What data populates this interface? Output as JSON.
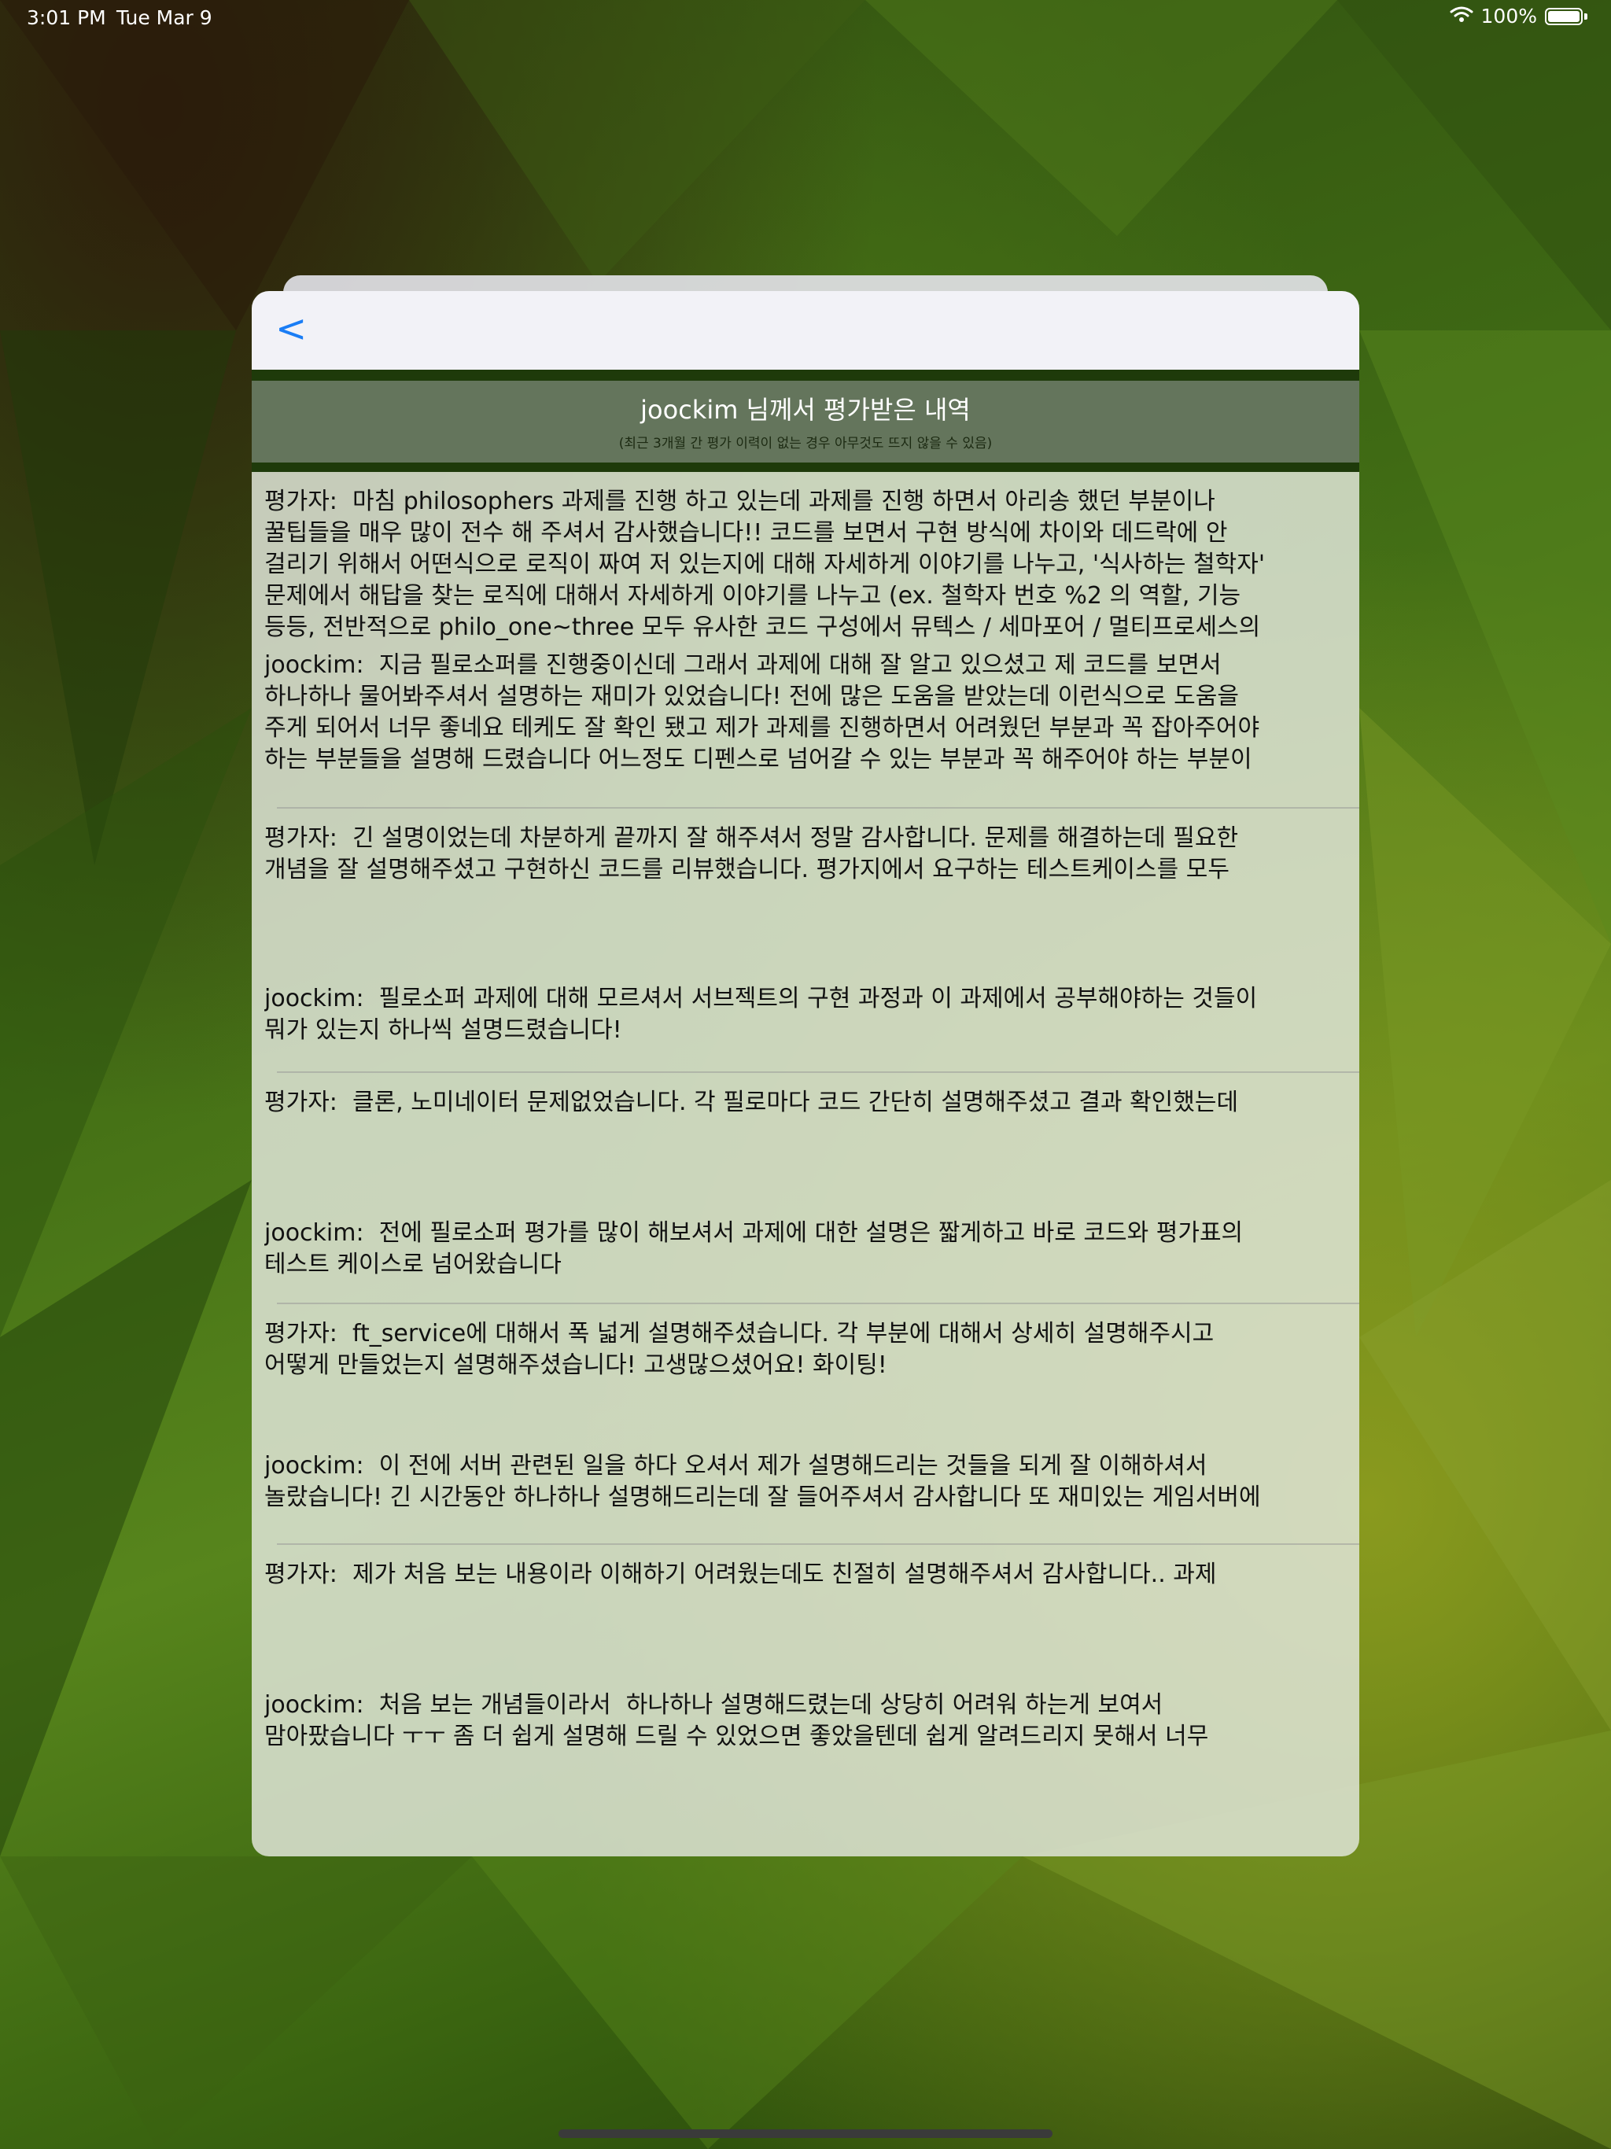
{
  "status_bar": {
    "time": "3:01 PM",
    "date": "Tue Mar 9",
    "battery_text": "100%",
    "battery_level": 1.0
  },
  "nav": {
    "back_label": "<"
  },
  "header": {
    "title": "joockim 님께서 평가받은 내역",
    "subtitle": "(최근 3개월 간 평가 이력이 없는 경우 아무것도 뜨지 않을 수 있음)"
  },
  "entries": [
    {
      "evaluator_comment": "평가자:  마침 philosophers 과제를 진행 하고 있는데 과제를 진행 하면서 아리송 했던 부분이나\n꿀팁들을 매우 많이 전수 해 주셔서 감사했습니다!! 코드를 보면서 구현 방식에 차이와 데드락에 안\n걸리기 위해서 어떤식으로 로직이 짜여 저 있는지에 대해 자세하게 이야기를 나누고, '식사하는 철학자'\n문제에서 해답을 찾는 로직에 대해서 자세하게 이야기를 나누고 (ex. 철학자 번호 %2 의 역할, 기능\n등등, 전반적으로 philo_one~three 모두 유사한 코드 구성에서 뮤텍스 / 세마포어 / 멀티프로세스의",
      "self_comment": "joockim:  지금 필로소퍼를 진행중이신데 그래서 과제에 대해 잘 알고 있으셨고 제 코드를 보면서\n하나하나 물어봐주셔서 설명하는 재미가 있었습니다! 전에 많은 도움을 받았는데 이런식으로 도움을\n주게 되어서 너무 좋네요 테케도 잘 확인 됐고 제가 과제를 진행하면서 어려웠던 부분과 꼭 잡아주어야\n하는 부분들을 설명해 드렸습니다 어느정도 디펜스로 넘어갈 수 있는 부분과 꼭 해주어야 하는 부분이"
    },
    {
      "evaluator_comment": "평가자:  긴 설명이었는데 차분하게 끝까지 잘 해주셔서 정말 감사합니다. 문제를 해결하는데 필요한\n개념을 잘 설명해주셨고 구현하신 코드를 리뷰했습니다. 평가지에서 요구하는 테스트케이스를 모두",
      "self_comment": "joockim:  필로소퍼 과제에 대해 모르셔서 서브젝트의 구현 과정과 이 과제에서 공부해야하는 것들이\n뭐가 있는지 하나씩 설명드렸습니다!"
    },
    {
      "evaluator_comment": "평가자:  클론, 노미네이터 문제없었습니다. 각 필로마다 코드 간단히 설명해주셨고 결과 확인했는데",
      "self_comment": "joockim:  전에 필로소퍼 평가를 많이 해보셔서 과제에 대한 설명은 짧게하고 바로 코드와 평가표의\n테스트 케이스로 넘어왔습니다"
    },
    {
      "evaluator_comment": "평가자:  ft_service에 대해서 폭 넓게 설명해주셨습니다. 각 부분에 대해서 상세히 설명해주시고\n어떻게 만들었는지 설명해주셨습니다! 고생많으셨어요! 화이팅!",
      "self_comment": "joockim:  이 전에 서버 관련된 일을 하다 오셔서 제가 설명해드리는 것들을 되게 잘 이해하셔서\n놀랐습니다! 긴 시간동안 하나하나 설명해드리는데 잘 들어주셔서 감사합니다 또 재미있는 게임서버에"
    },
    {
      "evaluator_comment": "평가자:  제가 처음 보는 내용이라 이해하기 어려웠는데도 친절히 설명해주셔서 감사합니다.. 과제",
      "self_comment": "joockim:  처음 보는 개념들이라서  하나하나 설명해드렸는데 상당히 어려워 하는게 보여서\n맘아팠습니다 ㅜㅜ 좀 더 쉽게 설명해 드릴 수 있었으면 좋았을텐데 쉽게 알려드리지 못해서 너무"
    }
  ]
}
